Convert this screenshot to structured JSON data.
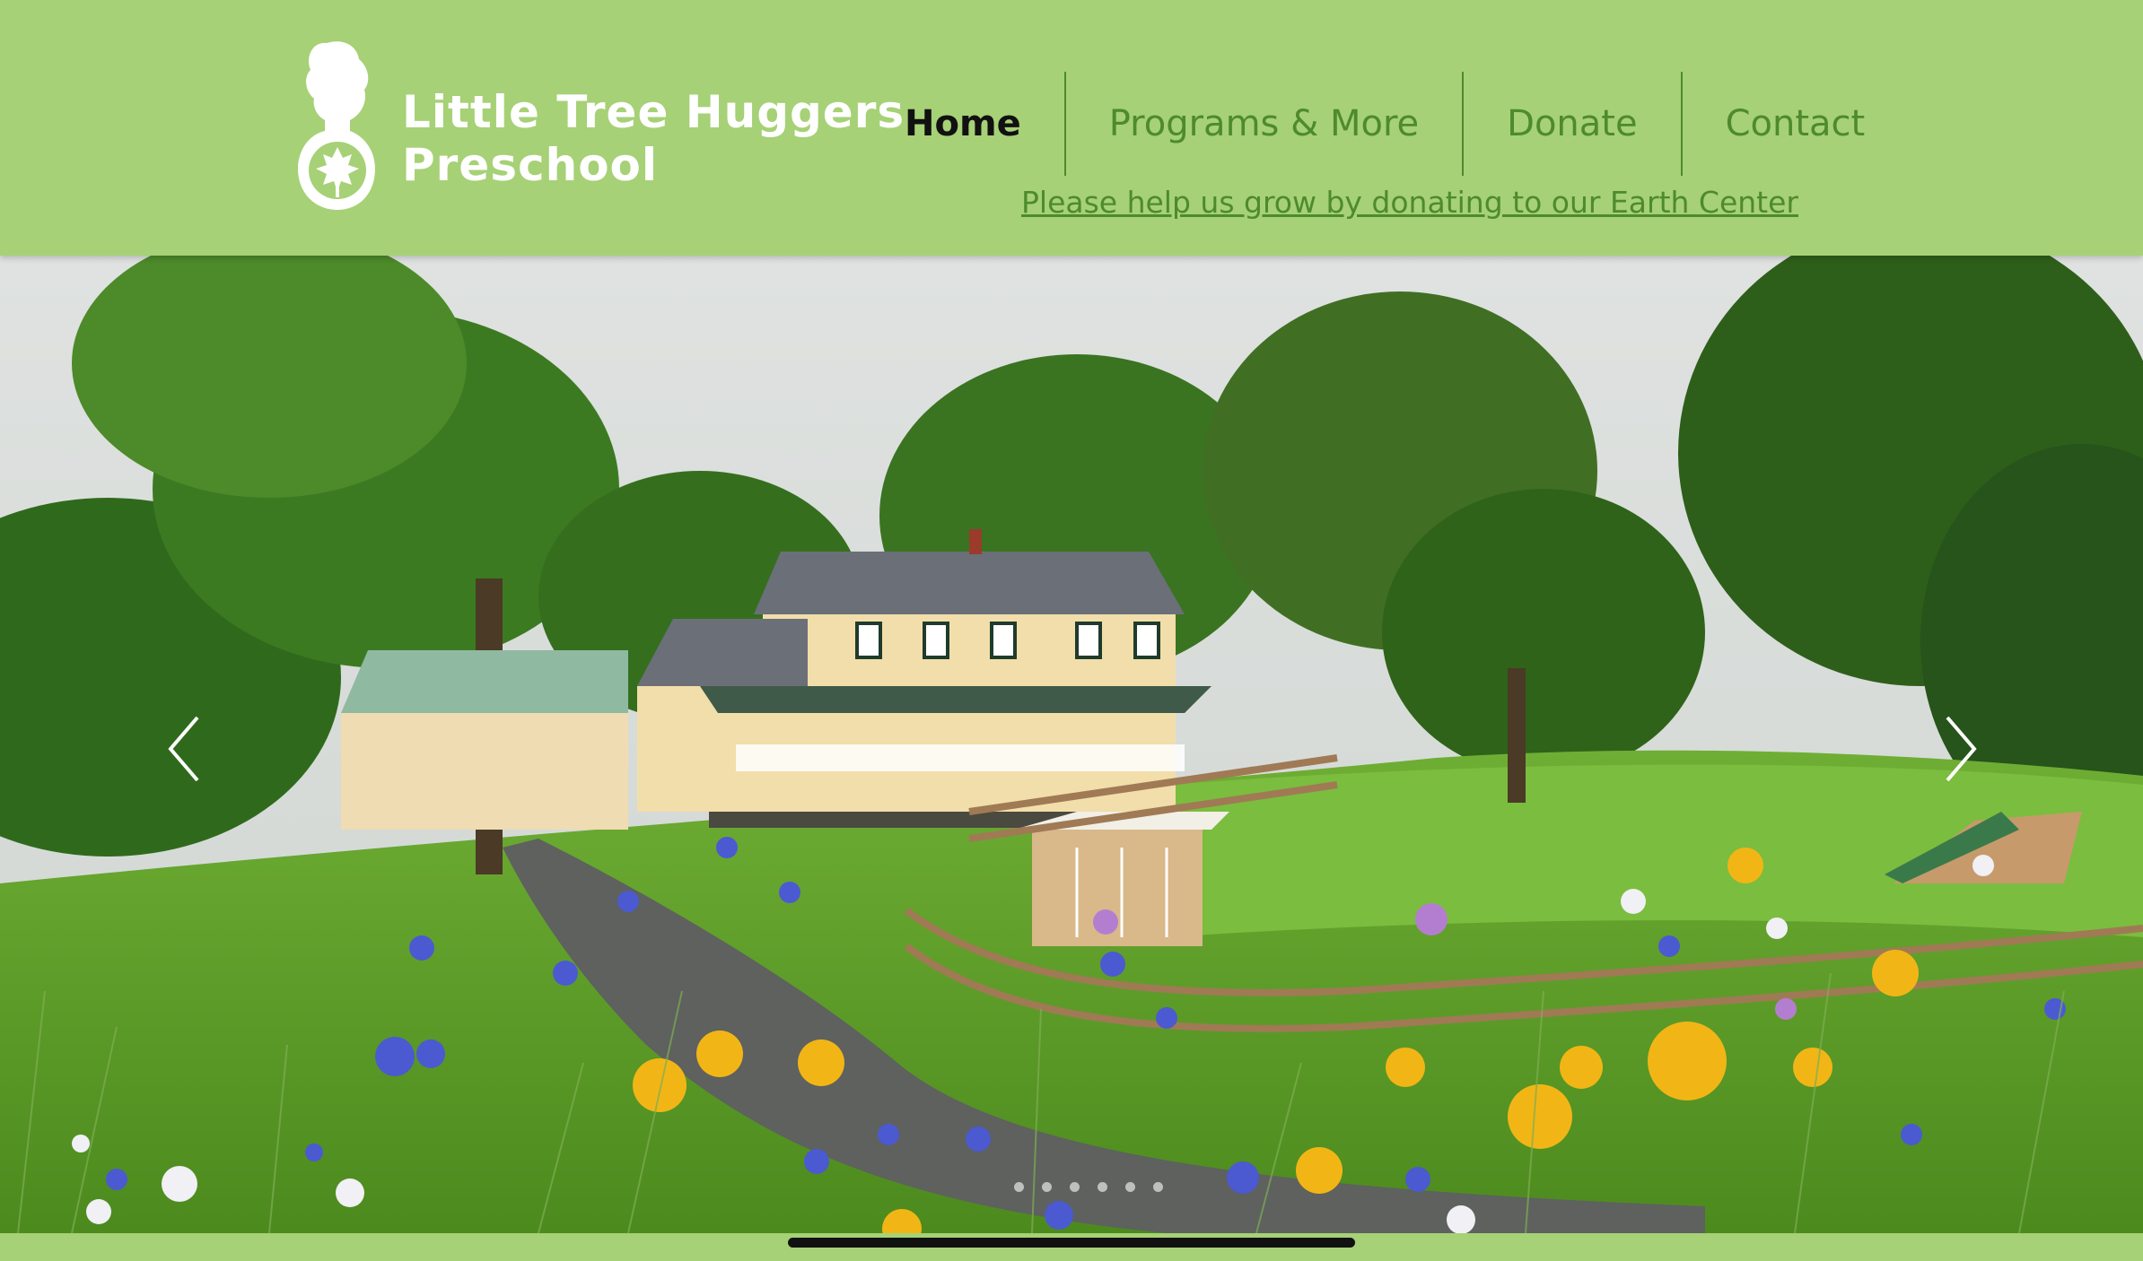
{
  "header": {
    "brand_line1": "Little Tree Huggers",
    "brand_line2": "Preschool",
    "logo_icon": "child-silhouette-tree-logo-icon",
    "colors": {
      "background": "#a6d176",
      "nav_text": "#4e8a2e",
      "active_text": "#111111",
      "brand_text": "#ffffff"
    }
  },
  "nav": {
    "items": [
      {
        "label": "Home",
        "active": true
      },
      {
        "label": "Programs & More",
        "active": false
      },
      {
        "label": "Donate",
        "active": false
      },
      {
        "label": "Contact",
        "active": false
      }
    ]
  },
  "donate_banner": {
    "text": "Please help us grow by donating to our Earth Center"
  },
  "slideshow": {
    "prev_icon": "chevron-left-icon",
    "next_icon": "chevron-right-icon",
    "slide_image": "farmhouse-with-wildflowers-photo"
  }
}
